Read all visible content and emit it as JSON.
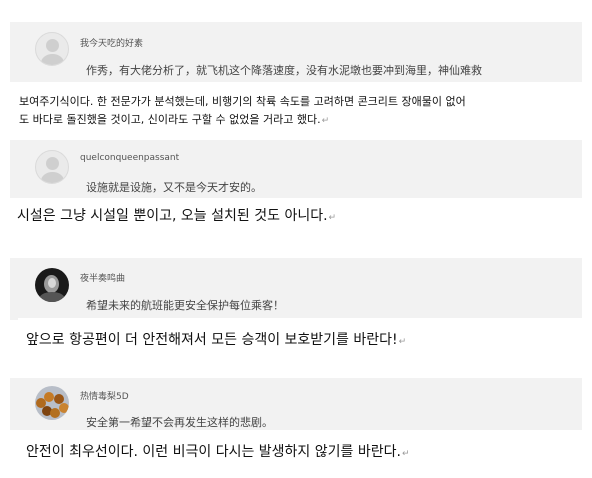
{
  "comments": [
    {
      "username": "我今天吃的好素",
      "comment": "作秀，有大佬分析了，就飞机这个降落速度，没有水泥墩也要冲到海里，神仙难救",
      "translation_lines": [
        "보여주기식이다. 한 전문가가 분석했는데, 비행기의 착륙 속도를 고려하면 콘크리트 장애물이 없어",
        "도 바다로 돌진했을 것이고, 신이라도 구할 수 없었을 거라고 했다."
      ],
      "avatar": "default-avatar"
    },
    {
      "username": "quelconqueenpassant",
      "comment": "设施就是设施，又不是今天才安的。",
      "translation_lines": [
        "시설은 그냥 시설일 뿐이고, 오늘 설치된 것도 아니다."
      ],
      "avatar": "default-avatar"
    },
    {
      "username": "夜半奏鸣曲",
      "comment": "希望未来的航班能更安全保护每位乘客！",
      "translation_lines": [
        "앞으로 항공편이 더 안전해져서 모든 승객이 보호받기를 바란다!"
      ],
      "avatar": "dark-portrait-avatar"
    },
    {
      "username": "热情毒梨5D",
      "comment": "安全第一希望不会再发生这样的悲剧。",
      "translation_lines": [
        "안전이 최우선이다. 이런 비극이 다시는 발생하지 않기를 바란다."
      ],
      "avatar": "beads-avatar"
    }
  ],
  "return_mark": "↵",
  "colors": {
    "gray_band": "#f2f2f2",
    "white_box": "#ffffff"
  }
}
